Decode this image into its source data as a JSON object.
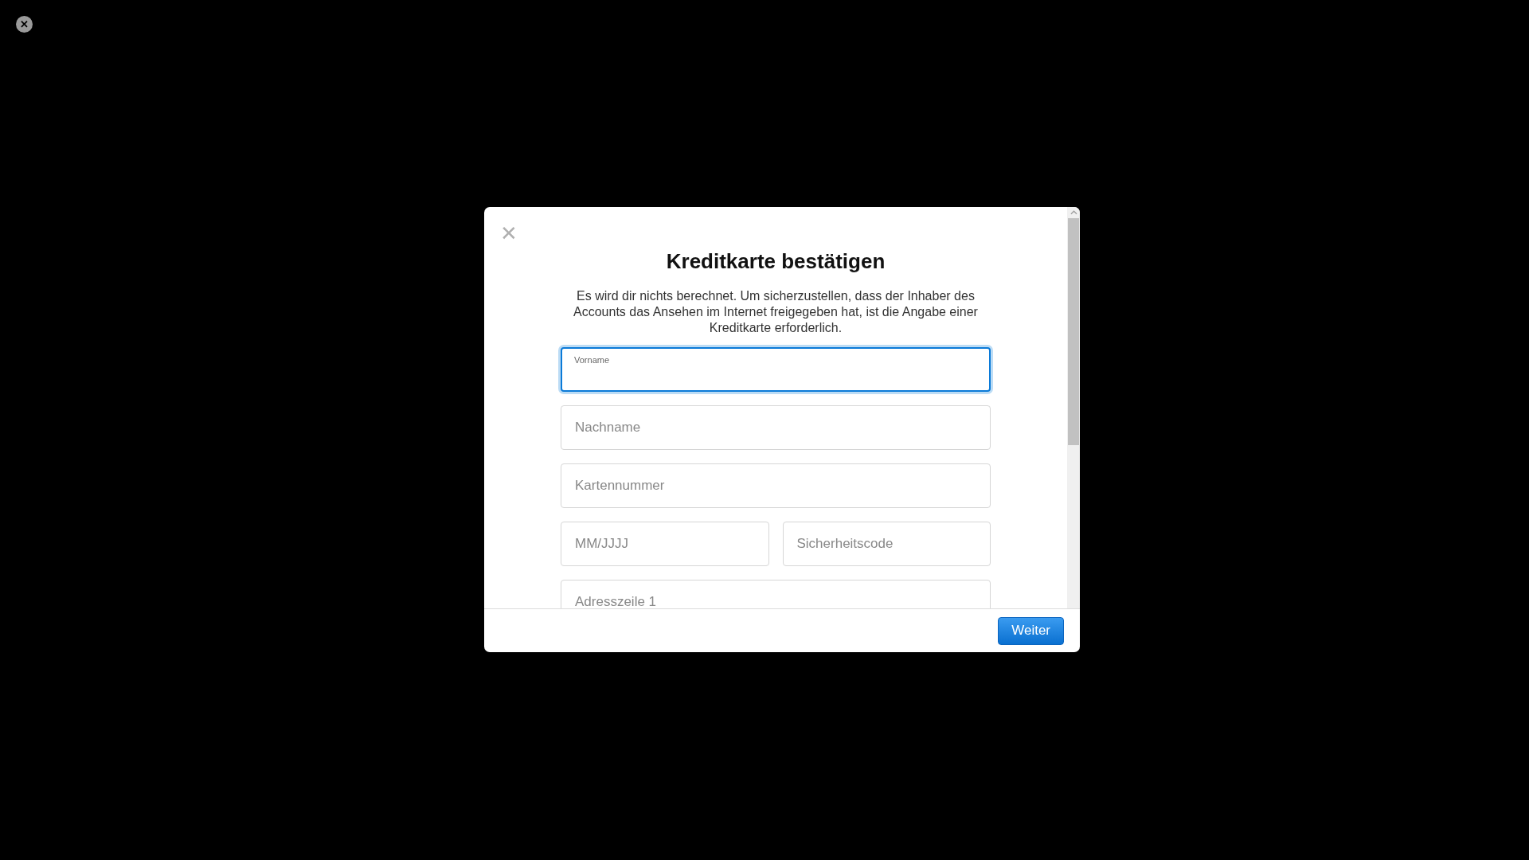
{
  "overlay": {
    "close_label": "✕"
  },
  "dialog": {
    "close_label": "✕",
    "title": "Kreditkarte bestätigen",
    "description": "Es wird dir nichts berechnet. Um sicherzustellen, dass der Inhaber des Accounts das Ansehen im Internet freigegeben hat, ist die Angabe einer Kreditkarte erforderlich.",
    "field_rows": [
      {
        "fields": [
          {
            "placeholder": "Vorname",
            "focused": true
          }
        ]
      },
      {
        "fields": [
          {
            "placeholder": "Nachname",
            "focused": false
          }
        ]
      },
      {
        "fields": [
          {
            "placeholder": "Kartennummer",
            "focused": false
          }
        ]
      },
      {
        "fields": [
          {
            "placeholder": "MM/JJJJ",
            "focused": false
          },
          {
            "placeholder": "Sicherheitscode",
            "focused": false
          }
        ]
      },
      {
        "fields": [
          {
            "placeholder": "Adresszeile 1",
            "focused": false
          }
        ]
      }
    ],
    "buttons": [
      "Weiter"
    ]
  }
}
